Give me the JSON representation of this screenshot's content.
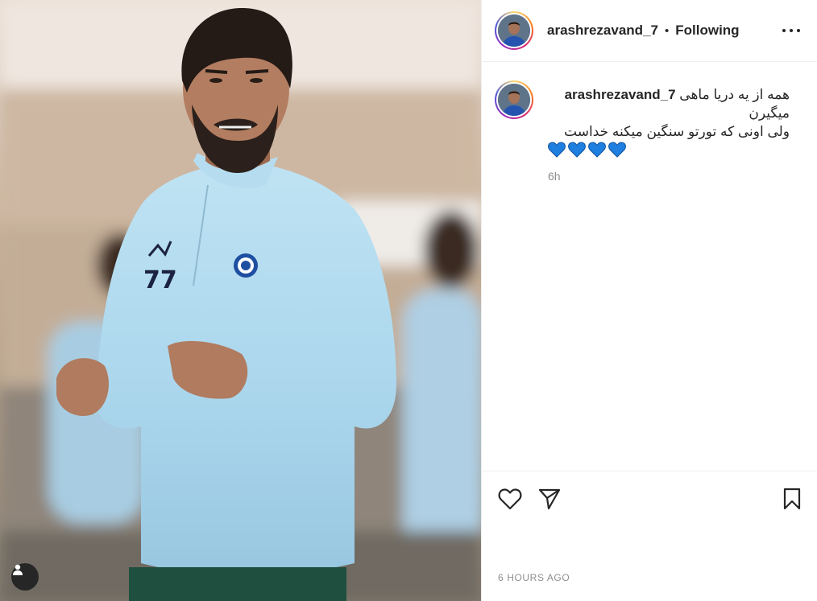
{
  "post": {
    "image_alt": "Player in light blue training top with number 77"
  },
  "header": {
    "username": "arashrezavand_7",
    "separator": "•",
    "follow_label": "Following"
  },
  "caption": {
    "username": "arashrezavand_7",
    "line1": "همه از یه دریا ماهی",
    "line2": "میگیرن",
    "line3": "ولی اونی که تورتو سنگین میکنه خداست",
    "hearts": [
      "💙",
      "💙",
      "💙",
      "💙"
    ],
    "age": "6h"
  },
  "footer": {
    "timestamp": "6 HOURS AGO"
  },
  "icons": {
    "like": "heart-outline-icon",
    "share": "paper-plane-icon",
    "save": "bookmark-icon",
    "more": "more-horizontal-icon",
    "tags": "user-tag-icon"
  },
  "colors": {
    "heart_blue": "#1f7fe0",
    "ring": "#d62976",
    "muted_text": "#8e8e8e"
  }
}
